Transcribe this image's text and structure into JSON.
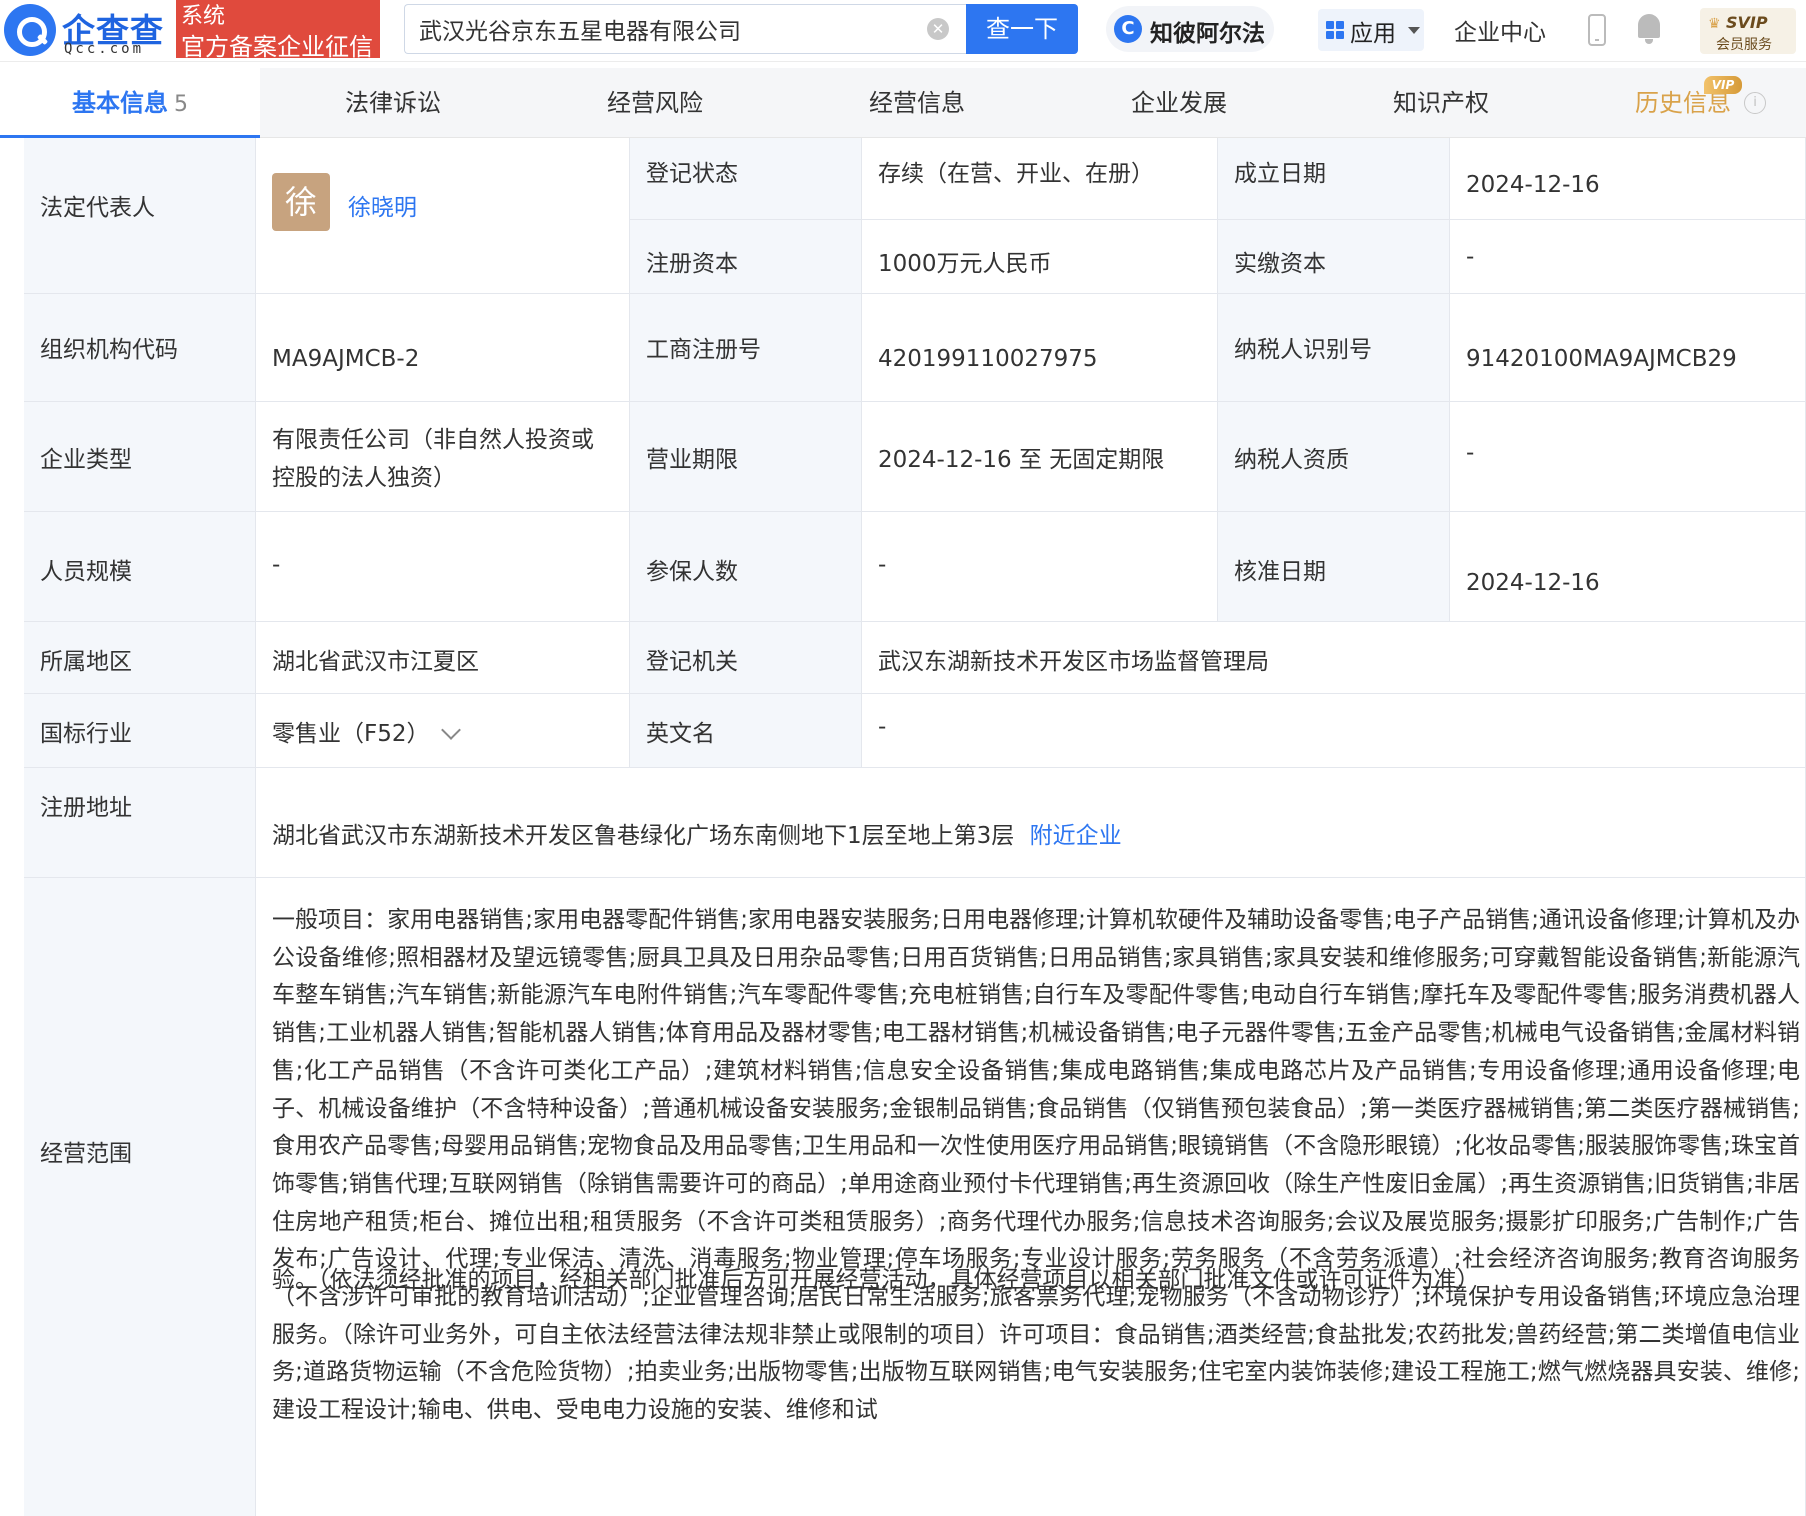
{
  "header": {
    "logo_cn": "企查查",
    "logo_en": "Qcc.com",
    "badge_line1": "系统",
    "badge_line2": "官方备案企业征信",
    "search_value": "武汉光谷京东五星电器有限公司",
    "search_button": "查一下",
    "zbaef": "知彼阿尔法",
    "app_label": "应用",
    "enterprise_center": "企业中心",
    "svip_line1": "SVIP",
    "svip_line2": "会员服务"
  },
  "tabs": [
    {
      "label": "基本信息",
      "count": "5"
    },
    {
      "label": "法律诉讼"
    },
    {
      "label": "经营风险"
    },
    {
      "label": "经营信息"
    },
    {
      "label": "企业发展"
    },
    {
      "label": "知识产权"
    },
    {
      "label": "历史信息"
    }
  ],
  "vip_tag": "VIP",
  "info": {
    "legal_rep_label": "法定代表人",
    "legal_rep_avatar": "徐",
    "legal_rep_name": "徐晓明",
    "reg_status_label": "登记状态",
    "reg_status": "存续（在营、开业、在册）",
    "found_date_label": "成立日期",
    "found_date": "2024-12-16",
    "reg_capital_label": "注册资本",
    "reg_capital": "1000万元人民币",
    "paid_capital_label": "实缴资本",
    "paid_capital": "-",
    "org_code_label": "组织机构代码",
    "org_code": "MA9AJMCB-2",
    "biz_reg_no_label": "工商注册号",
    "biz_reg_no": "420199110027975",
    "taxpayer_id_label": "纳税人识别号",
    "taxpayer_id": "91420100MA9AJMCB29",
    "ent_type_label": "企业类型",
    "ent_type_line1": "有限责任公司（非自然人投资或",
    "ent_type_line2": "控股的法人独资）",
    "biz_term_label": "营业期限",
    "biz_term": "2024-12-16 至 无固定期限",
    "taxpayer_qual_label": "纳税人资质",
    "taxpayer_qual": "-",
    "staff_size_label": "人员规模",
    "staff_size": "-",
    "insured_label": "参保人数",
    "insured": "-",
    "approval_date_label": "核准日期",
    "approval_date": "2024-12-16",
    "region_label": "所属地区",
    "region": "湖北省武汉市江夏区",
    "reg_authority_label": "登记机关",
    "reg_authority": "武汉东湖新技术开发区市场监督管理局",
    "industry_label": "国标行业",
    "industry": "零售业（F52）",
    "english_name_label": "英文名",
    "english_name": "-",
    "address_label": "注册地址",
    "address": "湖北省武汉市东湖新技术开发区鲁巷绿化广场东南侧地下1层至地上第3层",
    "nearby_link": "附近企业",
    "scope_label": "经营范围",
    "scope_text": "一般项目：家用电器销售;家用电器零配件销售;家用电器安装服务;日用电器修理;计算机软硬件及辅助设备零售;电子产品销售;通讯设备修理;计算机及办公设备维修;照相器材及望远镜零售;厨具卫具及日用杂品零售;日用百货销售;日用品销售;家具销售;家具安装和维修服务;可穿戴智能设备销售;新能源汽车整车销售;汽车销售;新能源汽车电附件销售;汽车零配件零售;充电桩销售;自行车及零配件零售;电动自行车销售;摩托车及零配件零售;服务消费机器人销售;工业机器人销售;智能机器人销售;体育用品及器材零售;电工器材销售;机械设备销售;电子元器件零售;五金产品零售;机械电气设备销售;金属材料销售;化工产品销售（不含许可类化工产品）;建筑材料销售;信息安全设备销售;集成电路销售;集成电路芯片及产品销售;专用设备修理;通用设备修理;电子、机械设备维护（不含特种设备）;普通机械设备安装服务;金银制品销售;食品销售（仅销售预包装食品）;第一类医疗器械销售;第二类医疗器械销售;食用农产品零售;母婴用品销售;宠物食品及用品零售;卫生用品和一次性使用医疗用品销售;眼镜销售（不含隐形眼镜）;化妆品零售;服装服饰零售;珠宝首饰零售;销售代理;互联网销售（除销售需要许可的商品）;单用途商业预付卡代理销售;再生资源回收（除生产性废旧金属）;再生资源销售;旧货销售;非居住房地产租赁;柜台、摊位出租;租赁服务（不含许可类租赁服务）;商务代理代办服务;信息技术咨询服务;会议及展览服务;摄影扩印服务;广告制作;广告发布;广告设计、代理;专业保洁、清洗、消毒服务;物业管理;停车场服务;专业设计服务;劳务服务（不含劳务派遣）;社会经济咨询服务;教育咨询服务（不含涉许可审批的教育培训活动）;企业管理咨询;居民日常生活服务;旅客票务代理;宠物服务（不含动物诊疗）;环境保护专用设备销售;环境应急治理服务。（除许可业务外，可自主依法经营法律法规非禁止或限制的项目）许可项目：食品销售;酒类经营;食盐批发;农药批发;兽药经营;第二类增值电信业务;道路货物运输（不含危险货物）;拍卖业务;出版物零售;出版物互联网销售;电气安装服务;住宅室内装饰装修;建设工程施工;燃气燃烧器具安装、维修;建设工程设计;输电、供电、受电电力设施的安装、维修和试",
    "scope_tail": "验。（依法须经批准的项目，经相关部门批准后方可开展经营活动，具体经营项目以相关部门批准文件或许可证件为准）"
  }
}
